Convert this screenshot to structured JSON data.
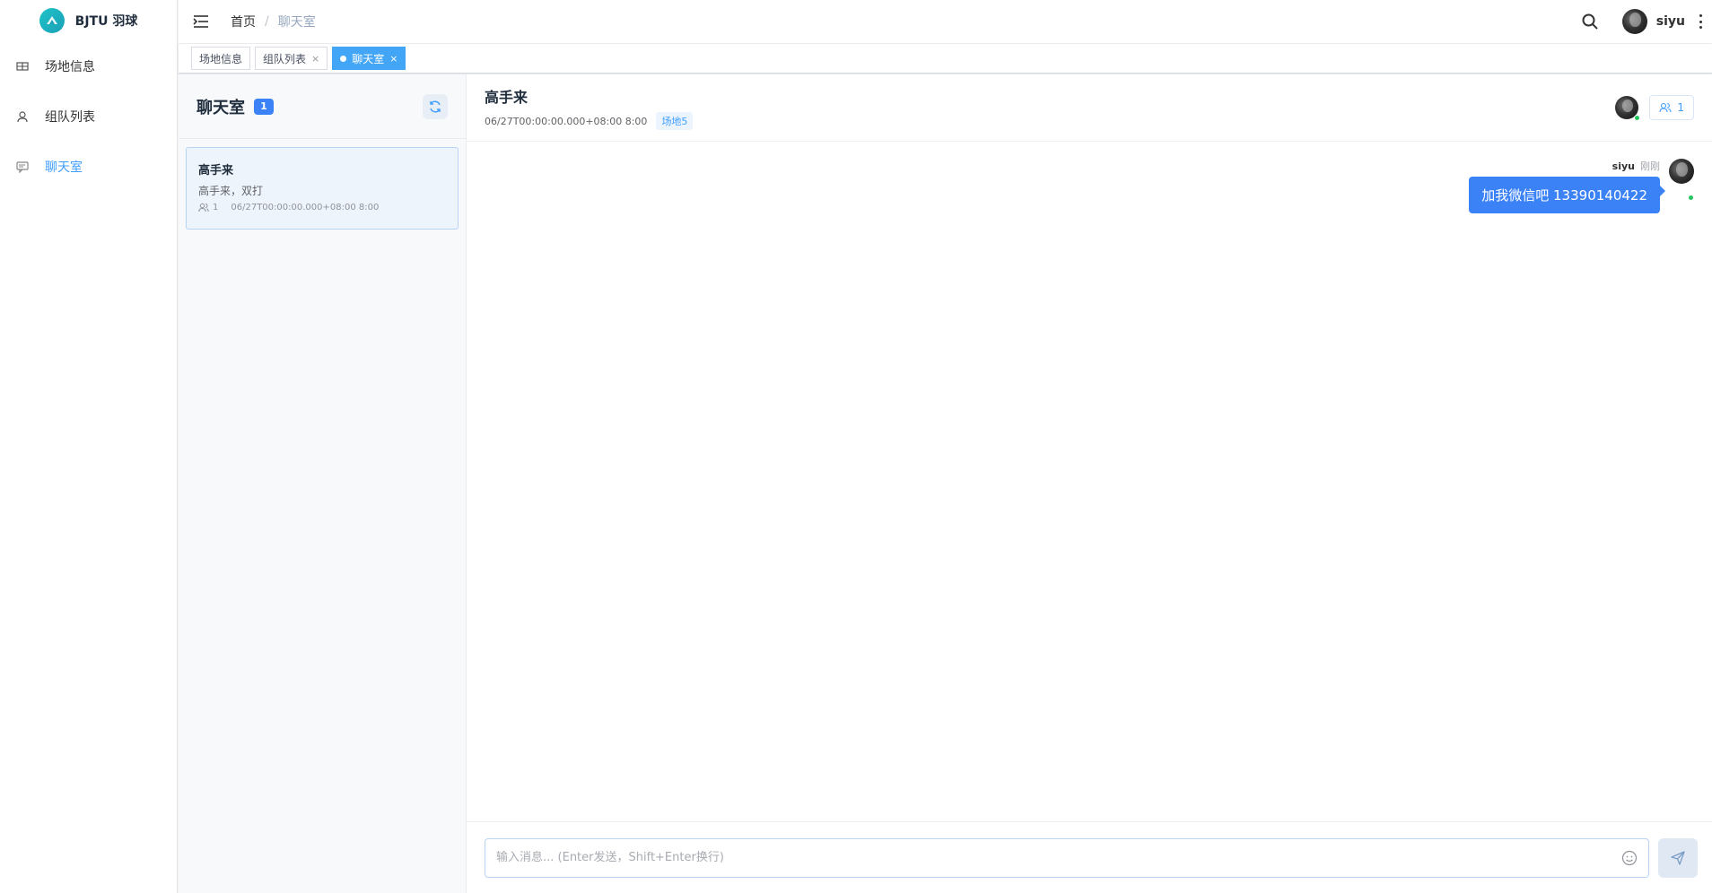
{
  "app": {
    "logo_text": "BJTU 羽球"
  },
  "sidebar": {
    "items": [
      {
        "label": "场地信息",
        "icon": "venue-icon"
      },
      {
        "label": "组队列表",
        "icon": "user-icon"
      },
      {
        "label": "聊天室",
        "icon": "chat-icon",
        "active": true
      }
    ]
  },
  "header": {
    "breadcrumb": {
      "home": "首页",
      "separator": "/",
      "current": "聊天室"
    },
    "user": {
      "name": "siyu"
    }
  },
  "tags": [
    {
      "label": "场地信息"
    },
    {
      "label": "组队列表",
      "close": "×"
    },
    {
      "label": "聊天室",
      "close": "×",
      "active": true
    }
  ],
  "room_list": {
    "title": "聊天室",
    "count": "1",
    "rooms": [
      {
        "name": "高手来",
        "desc": "高手来，双打",
        "members": "1",
        "date": "06/27T00:00:00.000+08:00 8:00"
      }
    ]
  },
  "chat": {
    "title": "高手来",
    "datetime": "06/27T00:00:00.000+08:00 8:00",
    "venue": "场地5",
    "member_count": "1",
    "messages": [
      {
        "sender": "siyu",
        "time": "刚刚",
        "text": "加我微信吧 13390140422"
      }
    ],
    "input": {
      "placeholder": "输入消息... (Enter发送，Shift+Enter换行)",
      "value": ""
    }
  },
  "colors": {
    "accent": "#3b82f6",
    "online": "#22c55e",
    "active_menu": "#409eff"
  }
}
